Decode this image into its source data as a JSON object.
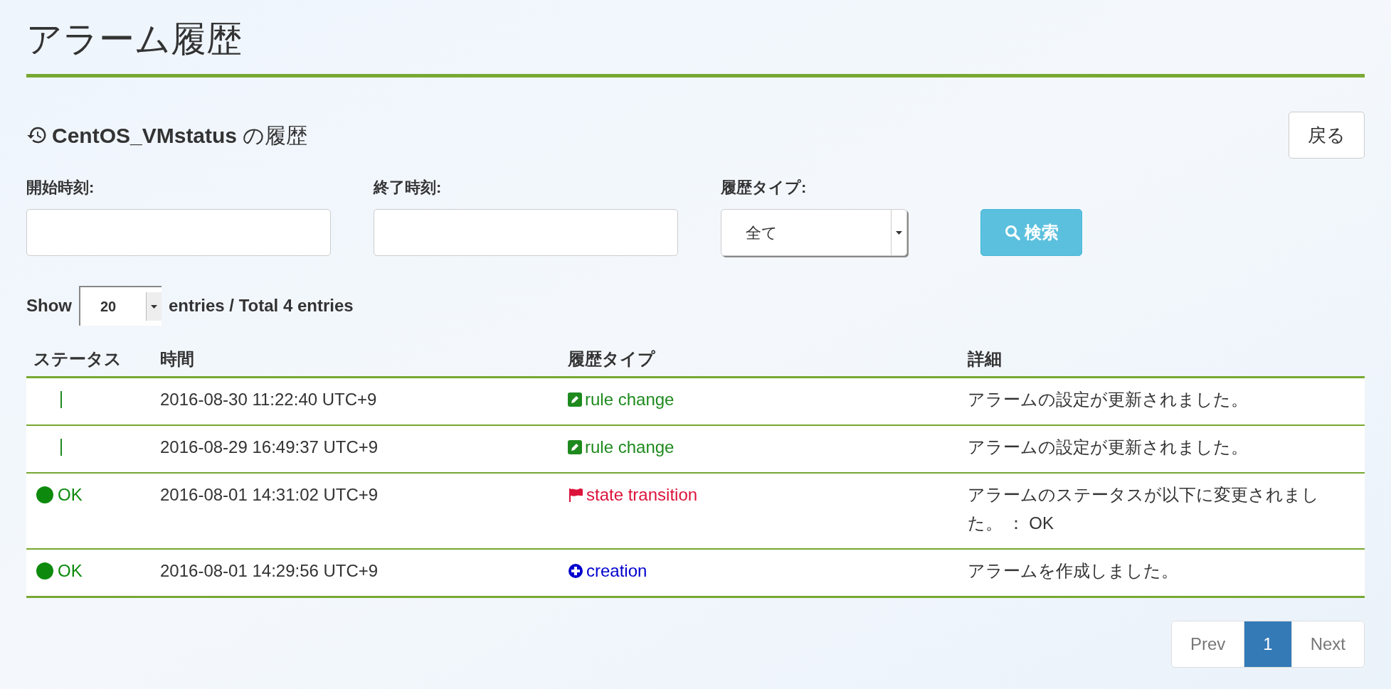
{
  "page_title": "アラーム履歴",
  "subtitle": {
    "name": "CentOS_VMstatus",
    "suffix": "の履歴"
  },
  "back_button": "戻る",
  "filters": {
    "start_label": "開始時刻:",
    "end_label": "終了時刻:",
    "type_label": "履歴タイプ:",
    "type_value": "全て",
    "search_button": "検索"
  },
  "length": {
    "show": "Show",
    "value": "20",
    "suffix": "entries / Total 4 entries"
  },
  "table": {
    "columns": [
      "ステータス",
      "時間",
      "履歴タイプ",
      "詳細"
    ],
    "rows": [
      {
        "status": {
          "kind": "bar"
        },
        "time": "2016-08-30 11:22:40 UTC+9",
        "type": {
          "kind": "edit",
          "label": "rule change",
          "color": "#1e8a1e"
        },
        "detail": "アラームの設定が更新されました。"
      },
      {
        "status": {
          "kind": "bar"
        },
        "time": "2016-08-29 16:49:37 UTC+9",
        "type": {
          "kind": "edit",
          "label": "rule change",
          "color": "#1e8a1e"
        },
        "detail": "アラームの設定が更新されました。"
      },
      {
        "status": {
          "kind": "ok",
          "label": "OK"
        },
        "time": "2016-08-01 14:31:02 UTC+9",
        "type": {
          "kind": "flag",
          "label": "state transition",
          "color": "#dc143c"
        },
        "detail": "アラームのステータスが以下に変更されました。 ： OK"
      },
      {
        "status": {
          "kind": "ok",
          "label": "OK"
        },
        "time": "2016-08-01 14:29:56 UTC+9",
        "type": {
          "kind": "plus",
          "label": "creation",
          "color": "#0000cd"
        },
        "detail": "アラームを作成しました。"
      }
    ]
  },
  "pagination": [
    {
      "label": "Prev",
      "selected": false
    },
    {
      "label": "1",
      "selected": true
    },
    {
      "label": "Next",
      "selected": false
    }
  ]
}
